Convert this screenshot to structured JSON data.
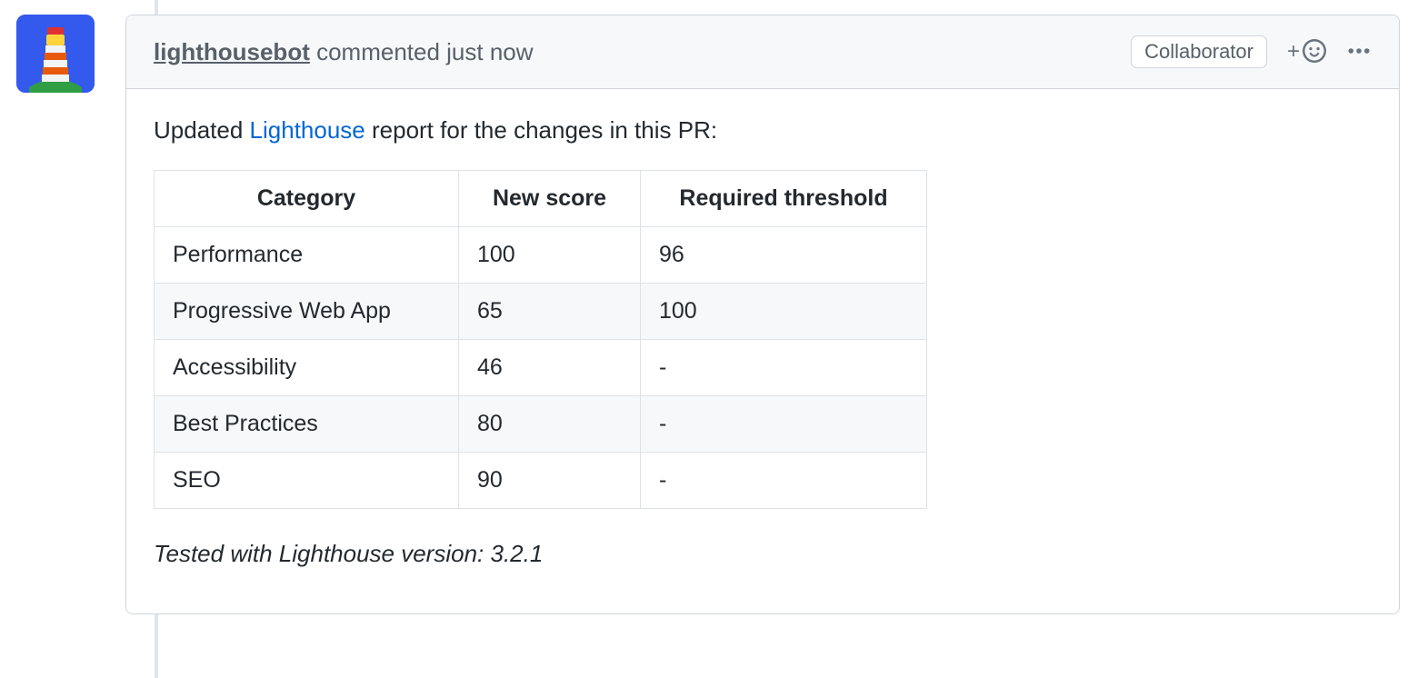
{
  "comment": {
    "author": "lighthousebot",
    "action_text": "commented just now",
    "badge": "Collaborator",
    "intro_prefix": "Updated ",
    "intro_link": "Lighthouse",
    "intro_suffix": " report for the changes in this PR:",
    "table": {
      "headers": [
        "Category",
        "New score",
        "Required threshold"
      ],
      "rows": [
        {
          "category": "Performance",
          "new_score": "100",
          "threshold": "96"
        },
        {
          "category": "Progressive Web App",
          "new_score": "65",
          "threshold": "100"
        },
        {
          "category": "Accessibility",
          "new_score": "46",
          "threshold": "-"
        },
        {
          "category": "Best Practices",
          "new_score": "80",
          "threshold": "-"
        },
        {
          "category": "SEO",
          "new_score": "90",
          "threshold": "-"
        }
      ]
    },
    "footnote": "Tested with Lighthouse version: 3.2.1"
  },
  "icons": {
    "avatar": "lighthouse-icon",
    "reaction": "smiley-icon",
    "menu": "kebab-icon"
  }
}
